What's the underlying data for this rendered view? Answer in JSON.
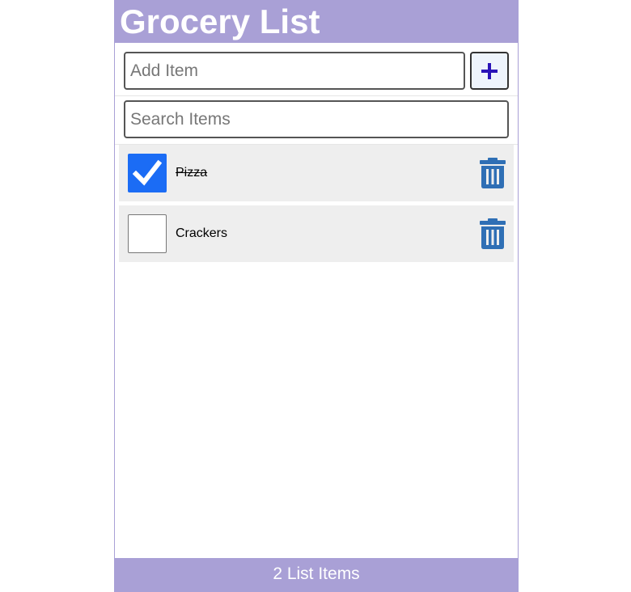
{
  "header": {
    "title": "Grocery List"
  },
  "add_item": {
    "placeholder": "Add Item",
    "value": "",
    "button_icon": "plus-icon"
  },
  "search": {
    "placeholder": "Search Items",
    "value": ""
  },
  "items": [
    {
      "label": "Pizza",
      "checked": true
    },
    {
      "label": "Crackers",
      "checked": false
    }
  ],
  "footer": {
    "count_text": "2 List Items"
  },
  "colors": {
    "accent": "#a9a0d6",
    "checkbox_checked": "#1b6cf5",
    "trash": "#2f6fb5",
    "plus": "#2b14b8",
    "item_bg": "#eeeeee"
  }
}
